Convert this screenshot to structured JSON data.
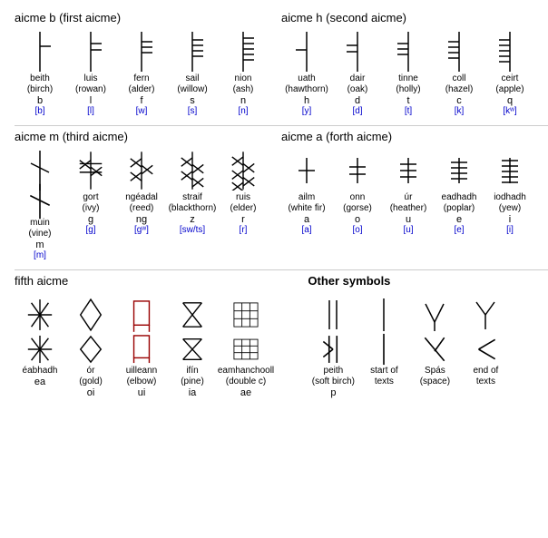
{
  "sections": {
    "aicme_b": {
      "title": "aicme b (first aicme)",
      "characters": [
        {
          "name": "beith",
          "sub": "(birch)",
          "letter": "b",
          "phonetic": "[b]"
        },
        {
          "name": "luis",
          "sub": "(rowan)",
          "letter": "l",
          "phonetic": "[l]"
        },
        {
          "name": "fern",
          "sub": "(alder)",
          "letter": "f",
          "phonetic": "[w]"
        },
        {
          "name": "sail",
          "sub": "(willow)",
          "letter": "s",
          "phonetic": "[s]"
        },
        {
          "name": "nion",
          "sub": "(ash)",
          "letter": "n",
          "phonetic": "[n]"
        }
      ]
    },
    "aicme_h": {
      "title": "aicme h (second aicme)",
      "characters": [
        {
          "name": "uath",
          "sub": "(hawthorn)",
          "letter": "h",
          "phonetic": "[y]"
        },
        {
          "name": "dair",
          "sub": "(oak)",
          "letter": "d",
          "phonetic": "[d]"
        },
        {
          "name": "tinne",
          "sub": "(holly)",
          "letter": "t",
          "phonetic": "[t]"
        },
        {
          "name": "coll",
          "sub": "(hazel)",
          "letter": "c",
          "phonetic": "[k]"
        },
        {
          "name": "ceirt",
          "sub": "(apple)",
          "letter": "q",
          "phonetic": "[kʷ]"
        }
      ]
    },
    "aicme_m": {
      "title": "aicme m (third aicme)",
      "characters": [
        {
          "name": "muin",
          "sub": "(vine)",
          "letter": "m",
          "phonetic": "[m]"
        },
        {
          "name": "gort",
          "sub": "(ivy)",
          "letter": "g",
          "phonetic": "[g]"
        },
        {
          "name": "ngéadal",
          "sub": "(reed)",
          "letter": "ng",
          "phonetic": "[gʷ]"
        },
        {
          "name": "straif",
          "sub": "(blackthorn)",
          "letter": "z",
          "phonetic": "[sw/ts]"
        },
        {
          "name": "ruis",
          "sub": "(elder)",
          "letter": "r",
          "phonetic": "[r]"
        }
      ]
    },
    "aicme_a": {
      "title": "aicme a (forth aicme)",
      "characters": [
        {
          "name": "ailm",
          "sub": "(white fir)",
          "letter": "a",
          "phonetic": "[a]"
        },
        {
          "name": "onn",
          "sub": "(gorse)",
          "letter": "o",
          "phonetic": "[o]"
        },
        {
          "name": "úr",
          "sub": "(heather)",
          "letter": "u",
          "phonetic": "[u]"
        },
        {
          "name": "eadhadh",
          "sub": "(poplar)",
          "letter": "e",
          "phonetic": "[e]"
        },
        {
          "name": "iodhadh",
          "sub": "(yew)",
          "letter": "i",
          "phonetic": "[i]"
        }
      ]
    },
    "fifth_aicme": {
      "title": "fifth aicme",
      "characters": [
        {
          "name": "éabhadh",
          "sub": "",
          "letter": "ea",
          "phonetic": ""
        },
        {
          "name": "ór",
          "sub": "(gold)",
          "letter": "oi",
          "phonetic": ""
        },
        {
          "name": "uilleann",
          "sub": "(elbow)",
          "letter": "ui",
          "phonetic": ""
        },
        {
          "name": "ifín",
          "sub": "(pine)",
          "letter": "ia",
          "phonetic": ""
        },
        {
          "name": "eamhanchooll",
          "sub": "(double c)",
          "letter": "ae",
          "phonetic": ""
        }
      ]
    },
    "other_symbols": {
      "title": "Other symbols",
      "characters": [
        {
          "name": "peith",
          "sub": "(soft birch)",
          "letter": "p",
          "phonetic": ""
        },
        {
          "name": "start of texts",
          "sub": "",
          "letter": "",
          "phonetic": ""
        },
        {
          "name": "Spás",
          "sub": "(space)",
          "letter": "",
          "phonetic": ""
        },
        {
          "name": "end of texts",
          "sub": "",
          "letter": "",
          "phonetic": ""
        }
      ]
    }
  }
}
